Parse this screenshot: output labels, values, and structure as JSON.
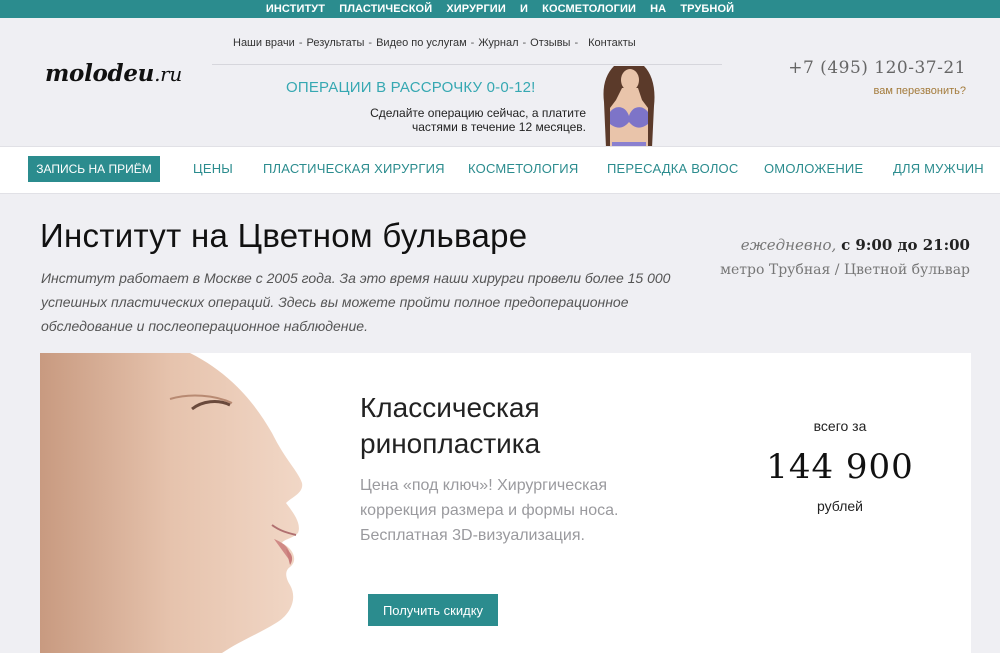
{
  "top_bar": {
    "text": "ИНСТИТУТ ПЛАСТИЧЕСКОЙ ХИРУРГИИ И КОСМЕТОЛОГИИ НА ТРУБНОЙ"
  },
  "logo": {
    "name": "molodeu",
    "suffix": ".ru"
  },
  "top_nav": [
    "Наши врачи",
    "Результаты",
    "Видео по услугам",
    "Журнал",
    "Отзывы",
    "Контакты"
  ],
  "top_nav_separator": "-",
  "promo": {
    "title": "ОПЕРАЦИИ В РАССРОЧКУ 0-0-12!",
    "text": "Сделайте операцию сейчас, а платите частями в течение 12 месяцев."
  },
  "contact": {
    "phone": "+7 (495) 120-37-21",
    "callback": "вам перезвонить?"
  },
  "main_nav": {
    "appointment": "ЗАПИСЬ НА ПРИЁМ",
    "items": [
      "ЦЕНЫ",
      "ПЛАСТИЧЕСКАЯ ХИРУРГИЯ",
      "КОСМЕТОЛОГИЯ",
      "ПЕРЕСАДКА ВОЛОС",
      "ОМОЛОЖЕНИЕ",
      "ДЛЯ МУЖЧИН"
    ]
  },
  "page": {
    "title": "Институт на Цветном бульваре",
    "intro": "Институт работает в Москве с 2005 года. За это время наши хирурги провели более 15 000 успешных пластических операций. Здесь вы можете пройти полное предоперационное обследование и послеоперационное наблюдение.",
    "hours_prefix": "ежедневно,",
    "hours_time": "с 9:00 до 21:00",
    "metro": "метро Трубная / Цветной бульвар"
  },
  "offer": {
    "title": "Классическая ринопластика",
    "description": "Цена «под ключ»! Хирургическая коррекция размера и формы носа. Бесплатная 3D-визуализация.",
    "price_prefix": "всего за",
    "price": "144 900",
    "price_unit": "рублей",
    "button": "Получить скидку"
  },
  "colors": {
    "accent": "#2b8c8e",
    "promo_title": "#36a8b2",
    "callback": "#a37a3a",
    "background": "#efeff3"
  }
}
